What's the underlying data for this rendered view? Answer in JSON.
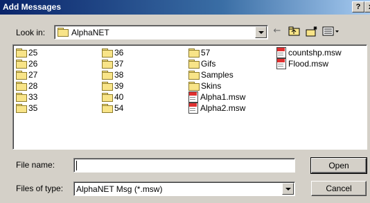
{
  "dialog": {
    "title": "Add Messages"
  },
  "titlebar_buttons": {
    "help": "?",
    "close": "x"
  },
  "lookin": {
    "label": "Look in:",
    "value": "AlphaNET"
  },
  "toolbar": {
    "back_icon": "back-arrow-icon",
    "up_icon": "up-folder-icon",
    "new_folder_icon": "new-folder-icon",
    "view_icon": "view-menu-icon"
  },
  "files": [
    {
      "name": "25",
      "type": "folder"
    },
    {
      "name": "26",
      "type": "folder"
    },
    {
      "name": "27",
      "type": "folder"
    },
    {
      "name": "28",
      "type": "folder"
    },
    {
      "name": "33",
      "type": "folder"
    },
    {
      "name": "35",
      "type": "folder"
    },
    {
      "name": "36",
      "type": "folder"
    },
    {
      "name": "37",
      "type": "folder"
    },
    {
      "name": "38",
      "type": "folder"
    },
    {
      "name": "39",
      "type": "folder"
    },
    {
      "name": "40",
      "type": "folder"
    },
    {
      "name": "54",
      "type": "folder"
    },
    {
      "name": "57",
      "type": "folder"
    },
    {
      "name": "Gifs",
      "type": "folder"
    },
    {
      "name": "Samples",
      "type": "folder"
    },
    {
      "name": "Skins",
      "type": "folder"
    },
    {
      "name": "Alpha1.msw",
      "type": "msw"
    },
    {
      "name": "Alpha2.msw",
      "type": "msw"
    },
    {
      "name": "countshp.msw",
      "type": "msw"
    },
    {
      "name": "Flood.msw",
      "type": "msw"
    }
  ],
  "filename": {
    "label": "File name:",
    "value": ""
  },
  "filetype": {
    "label": "Files of type:",
    "value": "AlphaNET Msg (*.msw)"
  },
  "buttons": {
    "open": "Open",
    "cancel": "Cancel"
  }
}
